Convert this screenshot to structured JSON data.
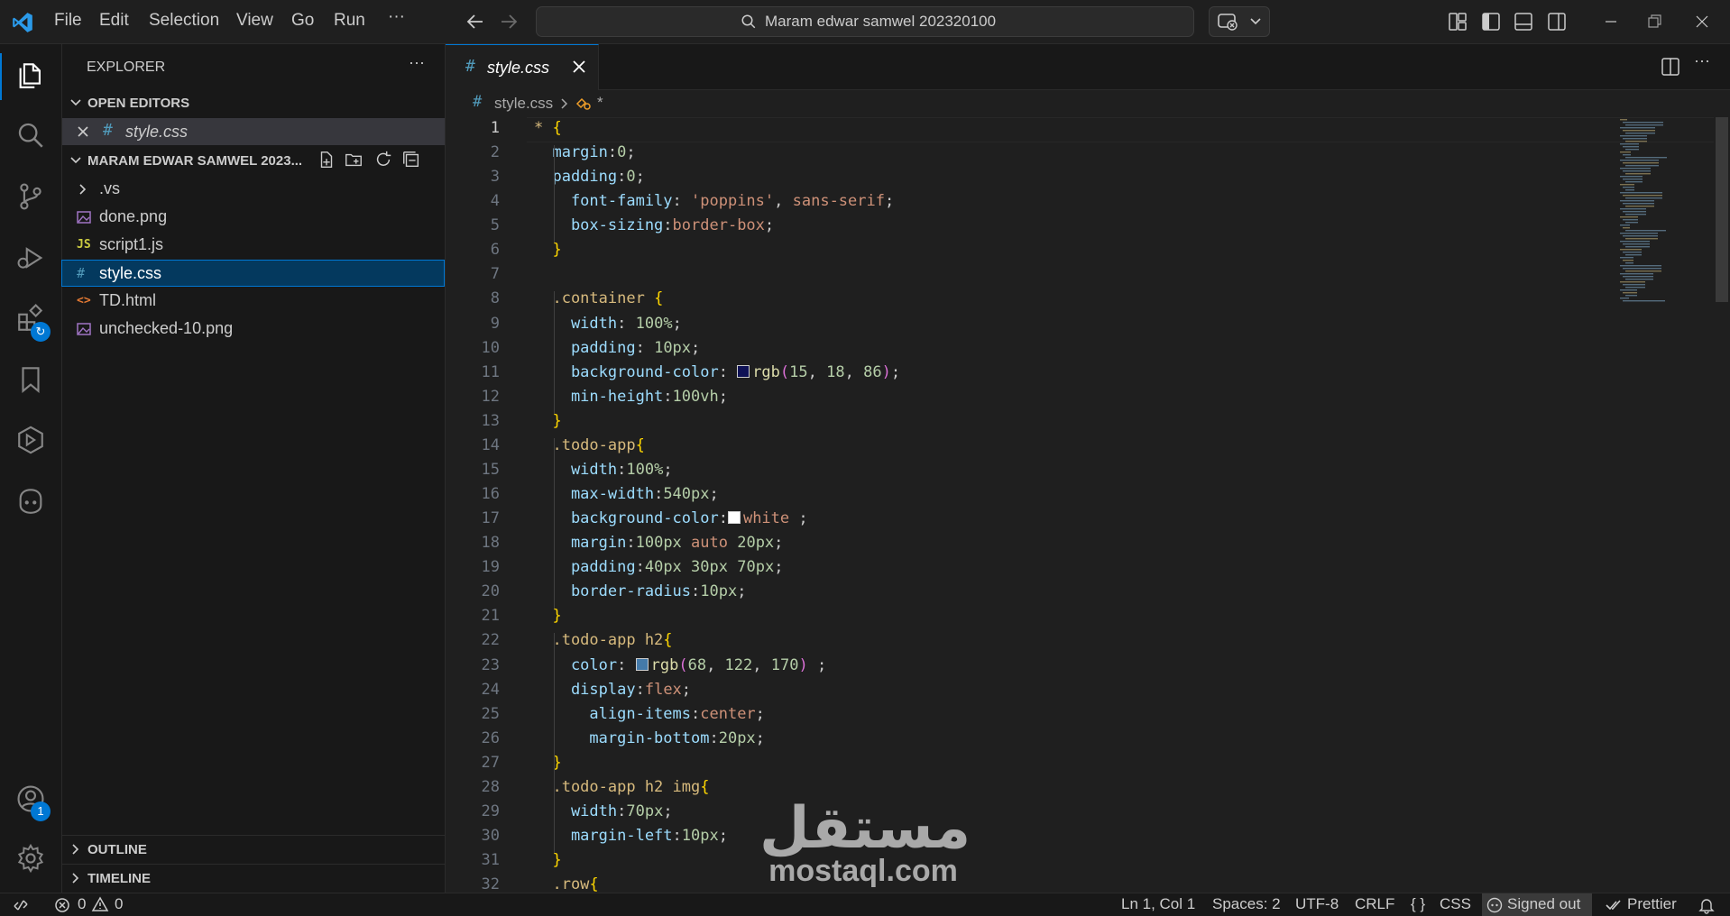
{
  "titlebar": {
    "menu": [
      "File",
      "Edit",
      "Selection",
      "View",
      "Go",
      "Run",
      "···"
    ],
    "search_text": "Maram edwar samwel 202320100"
  },
  "activitybar": {
    "accounts_badge": "1"
  },
  "sidebar": {
    "title": "EXPLORER",
    "more": "···",
    "open_editors_label": "OPEN EDITORS",
    "open_editor_file": "style.css",
    "folder_label": "MARAM EDWAR SAMWEL 2023...",
    "files": [
      {
        "name": ".vs",
        "icon": "chevron"
      },
      {
        "name": "done.png",
        "icon": "image"
      },
      {
        "name": "script1.js",
        "icon": "JS"
      },
      {
        "name": "style.css",
        "icon": "#"
      },
      {
        "name": "TD.html",
        "icon": "<>"
      },
      {
        "name": "unchecked-10.png",
        "icon": "image"
      }
    ],
    "outline_label": "OUTLINE",
    "timeline_label": "TIMELINE"
  },
  "editor": {
    "tab_label": "style.css",
    "breadcrumb_file": "style.css",
    "breadcrumb_symbol": "*",
    "current_line": 1,
    "lines": [
      [
        [
          "* ",
          "sel"
        ],
        [
          "{",
          "brace"
        ]
      ],
      [
        [
          "  margin",
          "prop"
        ],
        [
          ":",
          "punc"
        ],
        [
          "0",
          "val"
        ],
        [
          ";",
          "punc"
        ]
      ],
      [
        [
          "  padding",
          "prop"
        ],
        [
          ":",
          "punc"
        ],
        [
          "0",
          "val"
        ],
        [
          ";",
          "punc"
        ]
      ],
      [
        [
          "    font-family",
          "prop"
        ],
        [
          ": ",
          "punc"
        ],
        [
          "'poppins'",
          "kw"
        ],
        [
          ", ",
          "punc"
        ],
        [
          "sans-serif",
          "kw"
        ],
        [
          ";",
          "punc"
        ]
      ],
      [
        [
          "    box-sizing",
          "prop"
        ],
        [
          ":",
          "punc"
        ],
        [
          "border-box",
          "kw"
        ],
        [
          ";",
          "punc"
        ]
      ],
      [
        [
          "  }",
          "brace"
        ]
      ],
      [
        [
          "",
          ""
        ]
      ],
      [
        [
          "  .container ",
          "sel"
        ],
        [
          "{",
          "brace"
        ]
      ],
      [
        [
          "    width",
          "prop"
        ],
        [
          ": ",
          "punc"
        ],
        [
          "100%",
          "val"
        ],
        [
          ";",
          "punc"
        ]
      ],
      [
        [
          "    padding",
          "prop"
        ],
        [
          ": ",
          "punc"
        ],
        [
          "10px",
          "val"
        ],
        [
          ";",
          "punc"
        ]
      ],
      [
        [
          "    background-color",
          "prop"
        ],
        [
          ": ",
          "punc"
        ],
        [
          "#0f1256",
          "swatch"
        ],
        [
          "rgb",
          "func"
        ],
        [
          "(",
          "paren"
        ],
        [
          "15",
          "val"
        ],
        [
          ", ",
          "punc"
        ],
        [
          "18",
          "val"
        ],
        [
          ", ",
          "punc"
        ],
        [
          "86",
          "val"
        ],
        [
          ")",
          "paren"
        ],
        [
          ";",
          "punc"
        ]
      ],
      [
        [
          "    min-height",
          "prop"
        ],
        [
          ":",
          "punc"
        ],
        [
          "100vh",
          "val"
        ],
        [
          ";",
          "punc"
        ]
      ],
      [
        [
          "  }",
          "brace"
        ]
      ],
      [
        [
          "  .todo-app",
          "sel"
        ],
        [
          "{",
          "brace"
        ]
      ],
      [
        [
          "    width",
          "prop"
        ],
        [
          ":",
          "punc"
        ],
        [
          "100%",
          "val"
        ],
        [
          ";",
          "punc"
        ]
      ],
      [
        [
          "    max-width",
          "prop"
        ],
        [
          ":",
          "punc"
        ],
        [
          "540px",
          "val"
        ],
        [
          ";",
          "punc"
        ]
      ],
      [
        [
          "    background-color",
          "prop"
        ],
        [
          ":",
          "punc"
        ],
        [
          "#ffffff",
          "swatch"
        ],
        [
          "white",
          "kw"
        ],
        [
          " ;",
          "punc"
        ]
      ],
      [
        [
          "    margin",
          "prop"
        ],
        [
          ":",
          "punc"
        ],
        [
          "100px",
          "val"
        ],
        [
          " auto ",
          "kw"
        ],
        [
          "20px",
          "val"
        ],
        [
          ";",
          "punc"
        ]
      ],
      [
        [
          "    padding",
          "prop"
        ],
        [
          ":",
          "punc"
        ],
        [
          "40px",
          "val"
        ],
        [
          " ",
          "punc"
        ],
        [
          "30px",
          "val"
        ],
        [
          " ",
          "punc"
        ],
        [
          "70px",
          "val"
        ],
        [
          ";",
          "punc"
        ]
      ],
      [
        [
          "    border-radius",
          "prop"
        ],
        [
          ":",
          "punc"
        ],
        [
          "10px",
          "val"
        ],
        [
          ";",
          "punc"
        ]
      ],
      [
        [
          "  }",
          "brace"
        ]
      ],
      [
        [
          "  .todo-app h2",
          "sel"
        ],
        [
          "{",
          "brace"
        ]
      ],
      [
        [
          "    color",
          "prop"
        ],
        [
          ": ",
          "punc"
        ],
        [
          "#447aaa",
          "swatch"
        ],
        [
          "rgb",
          "func"
        ],
        [
          "(",
          "paren"
        ],
        [
          "68",
          "val"
        ],
        [
          ", ",
          "punc"
        ],
        [
          "122",
          "val"
        ],
        [
          ", ",
          "punc"
        ],
        [
          "170",
          "val"
        ],
        [
          ")",
          "paren"
        ],
        [
          " ;",
          "punc"
        ]
      ],
      [
        [
          "    display",
          "prop"
        ],
        [
          ":",
          "punc"
        ],
        [
          "flex",
          "kw"
        ],
        [
          ";",
          "punc"
        ]
      ],
      [
        [
          "      align-items",
          "prop"
        ],
        [
          ":",
          "punc"
        ],
        [
          "center",
          "kw"
        ],
        [
          ";",
          "punc"
        ]
      ],
      [
        [
          "      margin-bottom",
          "prop"
        ],
        [
          ":",
          "punc"
        ],
        [
          "20px",
          "val"
        ],
        [
          ";",
          "punc"
        ]
      ],
      [
        [
          "  }",
          "brace"
        ]
      ],
      [
        [
          "  .todo-app h2 img",
          "sel"
        ],
        [
          "{",
          "brace"
        ]
      ],
      [
        [
          "    width",
          "prop"
        ],
        [
          ":",
          "punc"
        ],
        [
          "70px",
          "val"
        ],
        [
          ";",
          "punc"
        ]
      ],
      [
        [
          "    margin-left",
          "prop"
        ],
        [
          ":",
          "punc"
        ],
        [
          "10px",
          "val"
        ],
        [
          ";",
          "punc"
        ]
      ],
      [
        [
          "  }",
          "brace"
        ]
      ],
      [
        [
          "  .row",
          "sel"
        ],
        [
          "{",
          "brace"
        ]
      ]
    ]
  },
  "statusbar": {
    "errors": "0",
    "warnings": "0",
    "position": "Ln 1, Col 1",
    "spaces": "Spaces: 2",
    "encoding": "UTF-8",
    "eol": "CRLF",
    "language": "CSS",
    "language_braces": "{ }",
    "account": "Signed out",
    "formatter": "Prettier"
  },
  "watermark": {
    "arabic": "مستقل",
    "latin": "mostaql.com"
  },
  "colors": {
    "accent": "#0078d4",
    "editor_bg": "#1f1f1f",
    "sidebar_bg": "#181818"
  }
}
